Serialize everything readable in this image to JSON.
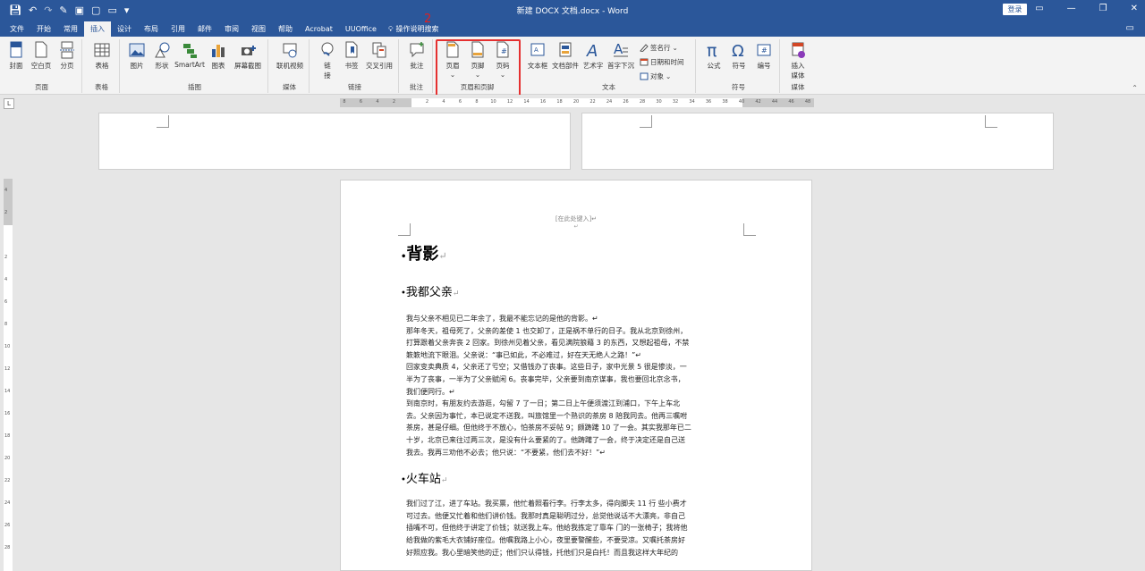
{
  "window": {
    "title": "新建 DOCX 文档.docx  -  Word",
    "login": "登录",
    "controls": [
      "▭",
      "—",
      "❐",
      "✕"
    ]
  },
  "tabs": [
    "文件",
    "开始",
    "常用",
    "插入",
    "设计",
    "布局",
    "引用",
    "邮件",
    "审阅",
    "视图",
    "帮助",
    "Acrobat",
    "UUOffice"
  ],
  "active_tab": "插入",
  "annotation_number": "2",
  "tell_me": "操作说明搜索",
  "ribbon": {
    "groups": {
      "pages": "页面",
      "tables": "表格",
      "illustrations": "插图",
      "media": "媒体",
      "links": "链接",
      "comments": "批注",
      "header_footer": "页眉和页脚",
      "text": "文本",
      "symbols": "符号",
      "embed": "媒体"
    },
    "buttons": {
      "cover": "封面",
      "blank_page": "空白页",
      "page_break": "分页",
      "table": "表格",
      "picture": "图片",
      "shapes": "形状",
      "smartart": "SmartArt",
      "chart": "图表",
      "screenshot": "屏幕截图",
      "online_video": "联机视频",
      "link1": "链",
      "link2": "接",
      "bookmark": "书签",
      "cross_ref": "交叉引用",
      "comment": "批注",
      "header": "页眉",
      "footer": "页脚",
      "page_number": "页码",
      "textbox": "文本框",
      "quick_parts": "文档部件",
      "wordart": "艺术字",
      "drop_cap": "首字下沉",
      "signature": "签名行",
      "datetime": "日期和时间",
      "object": "对象",
      "equation": "公式",
      "symbol": "符号",
      "numbering": "编号",
      "insert_media1": "插入",
      "insert_media2": "媒体"
    }
  },
  "ruler": {
    "ticks": [
      "8",
      "6",
      "4",
      "2",
      "",
      "2",
      "4",
      "6",
      "8",
      "10",
      "12",
      "14",
      "16",
      "18",
      "20",
      "22",
      "24",
      "26",
      "28",
      "30",
      "32",
      "34",
      "36",
      "38",
      "40",
      "42",
      "44",
      "46",
      "48"
    ],
    "vticks": [
      "4",
      "2",
      "",
      "2",
      "4",
      "6",
      "8",
      "10",
      "12",
      "14",
      "16",
      "18",
      "20",
      "22",
      "24",
      "26",
      "28"
    ]
  },
  "document": {
    "header_placeholder": "[在此处键入]↵",
    "header_mark": "↵",
    "paragraph_mark": "↵",
    "bullet": "•",
    "title": "背影",
    "heading2": "我都父亲",
    "para1": [
      "我与父亲不相见已二年余了，我最不能忘记的是他的背影。↵",
      "那年冬天，祖母死了，父亲的差使 1 也交卸了，正是祸不单行的日子。我从北京到徐州，",
      "打算跟着父亲奔丧 2 回家。到徐州见着父亲，看见满院狼藉 3 的东西，又想起祖母，不禁",
      "簌簌地流下眼泪。父亲说：“事已如此，不必难过，好在天无绝人之路！”↵",
      "回家变卖典质 4，父亲还了亏空；又借钱办了丧事。这些日子，家中光景 5 很是惨淡，一",
      "半为了丧事，一半为了父亲赋闲 6。丧事完毕，父亲要到南京谋事，我也要回北京念书，",
      "我们便同行。↵",
      "到南京时，有朋友约去游逛，勾留 7 了一日；第二日上午便须渡江到浦口，下午上车北",
      "去。父亲因为事忙，本已说定不送我，叫旅馆里一个熟识的茶房 8 陪我同去。他再三嘱咐",
      "茶房，甚是仔细。但他终于不放心，怕茶房不妥帖 9；颇踌躇 10 了一会。其实我那年已二",
      "十岁，北京已来往过两三次，是没有什么要紧的了。他踌躇了一会，终于决定还是自己送",
      "我去。我再三劝他不必去；他只说：“不要紧，他们去不好！”↵"
    ],
    "heading3": "火车站",
    "para2": [
      "我们过了江，进了车站。我买票，他忙着照看行李。行李太多，得向脚夫 11 行 些小费才",
      "可过去。他便又忙着和他们讲价钱。我那时真是聪明过分，总觉他说话不大漂亮，非自己",
      "插嘴不可，但他终于讲定了价钱；就送我上车。他给我拣定了靠车 门的一张椅子；我将他",
      "给我做的紫毛大衣铺好座位。他嘱我路上小心，夜里要警醒些，不要受凉。又嘱托茶房好",
      "好照应我。我心里暗笑他的迂；他们只认得钱，托他们只是白托！而且我这样大年纪的"
    ]
  }
}
